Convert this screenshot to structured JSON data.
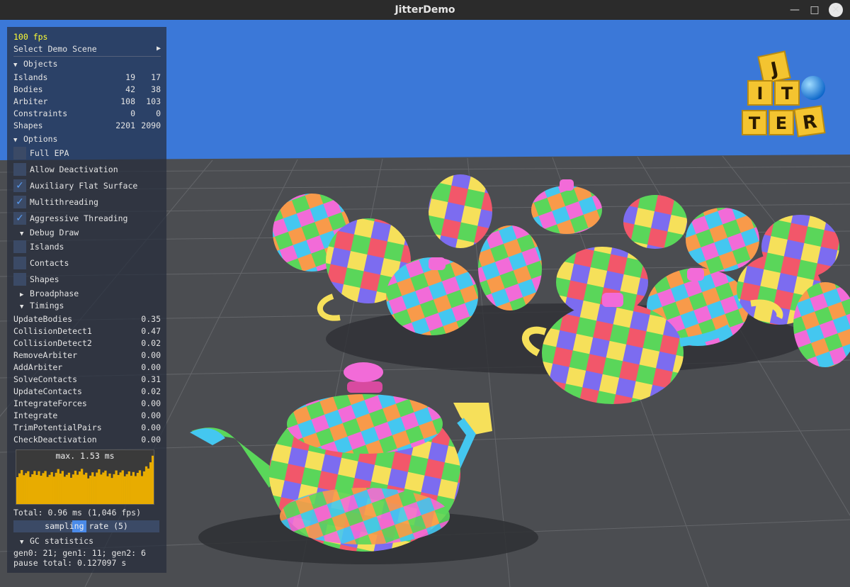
{
  "window": {
    "title": "JitterDemo",
    "min_icon": "minimize-icon",
    "max_icon": "maximize-icon",
    "close_icon": "close-icon"
  },
  "logo": {
    "letters": [
      "J",
      "I",
      "T",
      "T",
      "E",
      "R"
    ]
  },
  "panel": {
    "fps": "100 fps",
    "select_demo": "Select Demo Scene",
    "objects": {
      "header": "Objects",
      "rows": [
        {
          "label": "Islands",
          "a": "19",
          "b": "17"
        },
        {
          "label": "Bodies",
          "a": "42",
          "b": "38"
        },
        {
          "label": "Arbiter",
          "a": "108",
          "b": "103"
        },
        {
          "label": "Constraints",
          "a": "0",
          "b": "0"
        },
        {
          "label": "Shapes",
          "a": "2201",
          "b": "2090"
        }
      ]
    },
    "options": {
      "header": "Options",
      "items": [
        {
          "label": "Full EPA",
          "checked": false
        },
        {
          "label": "Allow Deactivation",
          "checked": false
        },
        {
          "label": "Auxiliary Flat Surface",
          "checked": true
        },
        {
          "label": "Multithreading",
          "checked": true
        },
        {
          "label": "Aggressive Threading",
          "checked": true
        }
      ]
    },
    "debug_draw": {
      "header": "Debug Draw",
      "items": [
        {
          "label": "Islands",
          "checked": false
        },
        {
          "label": "Contacts",
          "checked": false
        },
        {
          "label": "Shapes",
          "checked": false
        }
      ]
    },
    "broadphase": {
      "header": "Broadphase"
    },
    "timings": {
      "header": "Timings",
      "rows": [
        {
          "label": "UpdateBodies",
          "value": "0.35"
        },
        {
          "label": "CollisionDetect1",
          "value": "0.47"
        },
        {
          "label": "CollisionDetect2",
          "value": "0.02"
        },
        {
          "label": "RemoveArbiter",
          "value": "0.00"
        },
        {
          "label": "AddArbiter",
          "value": "0.00"
        },
        {
          "label": "SolveContacts",
          "value": "0.31"
        },
        {
          "label": "UpdateContacts",
          "value": "0.02"
        },
        {
          "label": "IntegrateForces",
          "value": "0.00"
        },
        {
          "label": "Integrate",
          "value": "0.00"
        },
        {
          "label": "TrimPotentialPairs",
          "value": "0.00"
        },
        {
          "label": "CheckDeactivation",
          "value": "0.00"
        }
      ],
      "graph_title": "max. 1.53 ms",
      "total": "Total: 0.96 ms (1,046 fps)",
      "sampling": "sampling rate (5)",
      "sampling_value": 5
    },
    "gc": {
      "header": "GC statistics",
      "line1": "gen0: 21; gen1: 11; gen2: 6",
      "line2": "pause total: 0.127097 s"
    }
  },
  "colors": {
    "sky": "#3b78d8",
    "floor": "#4a4c50",
    "graph_bar": "#e8ac00",
    "fps_text": "#ffff33",
    "checkbox_accent": "#5a9cf0"
  }
}
